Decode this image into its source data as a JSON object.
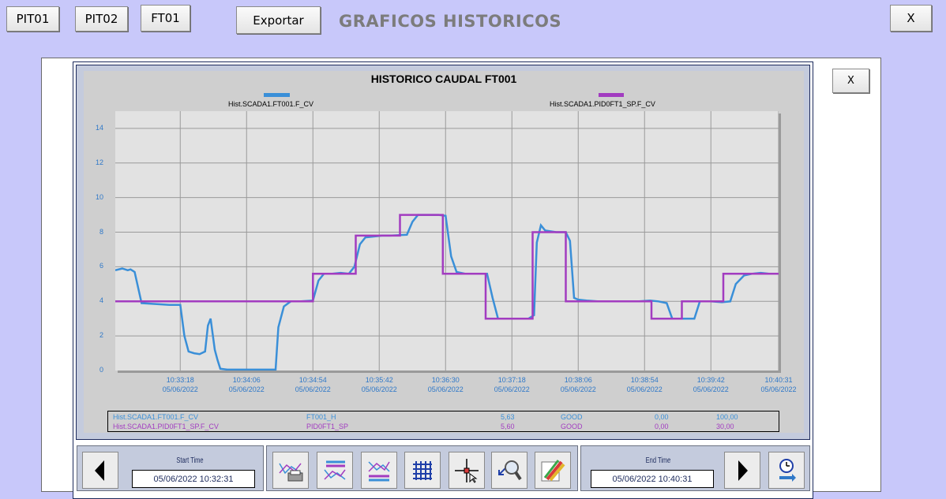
{
  "toolbar": {
    "buttons": [
      "PIT01",
      "PIT02",
      "FT01"
    ],
    "export_label": "Exportar",
    "title": "GRAFICOS HISTORICOS",
    "close_label": "X"
  },
  "panel": {
    "close_label": "X"
  },
  "chart_data": {
    "type": "line",
    "title": "HISTORICO CAUDAL FT001",
    "ylim": [
      0,
      15
    ],
    "yticks": [
      "0",
      "2",
      "4",
      "6",
      "8",
      "10",
      "12",
      "14"
    ],
    "x_times": [
      "10:33:18",
      "10:34:06",
      "10:34:54",
      "10:35:42",
      "10:36:30",
      "10:37:18",
      "10:38:06",
      "10:38:54",
      "10:39:42",
      "10:40:31"
    ],
    "x_dates": [
      "05/06/2022",
      "05/06/2022",
      "05/06/2022",
      "05/06/2022",
      "05/06/2022",
      "05/06/2022",
      "05/06/2022",
      "05/06/2022",
      "05/06/2022",
      "05/06/2022"
    ],
    "grid": true,
    "series": [
      {
        "name": "Hist.SCADA1.FT001.F_CV",
        "color": "#3a8fd8",
        "x": [
          "10:32:31",
          "10:32:36",
          "10:32:40",
          "10:32:42",
          "10:32:45",
          "10:32:50",
          "10:33:00",
          "10:33:10",
          "10:33:16",
          "10:33:18",
          "10:33:21",
          "10:33:24",
          "10:33:28",
          "10:33:32",
          "10:33:36",
          "10:33:38",
          "10:33:40",
          "10:33:43",
          "10:33:45",
          "10:33:47",
          "10:33:52",
          "10:33:54",
          "10:34:00",
          "10:34:10",
          "10:34:20",
          "10:34:27",
          "10:34:29",
          "10:34:33",
          "10:34:38",
          "10:34:45",
          "10:34:54",
          "10:34:58",
          "10:35:02",
          "10:35:08",
          "10:35:14",
          "10:35:20",
          "10:35:24",
          "10:35:28",
          "10:35:32",
          "10:35:38",
          "10:35:44",
          "10:35:50",
          "10:36:02",
          "10:36:06",
          "10:36:10",
          "10:36:15",
          "10:36:25",
          "10:36:30",
          "10:36:34",
          "10:36:38",
          "10:36:44",
          "10:36:50",
          "10:37:00",
          "10:37:04",
          "10:37:08",
          "10:37:14",
          "10:37:20",
          "10:37:30",
          "10:37:34",
          "10:37:36",
          "10:37:39",
          "10:37:42",
          "10:37:50",
          "10:37:57",
          "10:38:00",
          "10:38:03",
          "10:38:06",
          "10:38:12",
          "10:38:20",
          "10:38:30",
          "10:38:40",
          "10:38:50",
          "10:38:58",
          "10:39:04",
          "10:39:10",
          "10:39:14",
          "10:39:20",
          "10:39:30",
          "10:39:34",
          "10:39:42",
          "10:39:50",
          "10:39:56",
          "10:40:00",
          "10:40:06",
          "10:40:12",
          "10:40:18",
          "10:40:24",
          "10:40:31"
        ],
        "values": [
          5.8,
          5.9,
          5.8,
          5.85,
          5.7,
          3.9,
          3.85,
          3.8,
          3.8,
          3.8,
          2.0,
          1.1,
          1.0,
          0.95,
          1.1,
          2.6,
          3.0,
          1.2,
          0.6,
          0.1,
          0.05,
          0.05,
          0.05,
          0.05,
          0.05,
          0.05,
          2.5,
          3.7,
          4.0,
          4.0,
          4.05,
          5.2,
          5.6,
          5.6,
          5.65,
          5.6,
          6.0,
          7.3,
          7.7,
          7.75,
          7.8,
          7.8,
          7.85,
          8.6,
          9.0,
          9.0,
          9.0,
          8.95,
          6.6,
          5.7,
          5.6,
          5.6,
          5.6,
          4.2,
          3.0,
          3.0,
          3.0,
          3.0,
          3.2,
          7.4,
          8.4,
          8.1,
          8.0,
          8.0,
          7.5,
          4.2,
          4.1,
          4.05,
          4.0,
          4.0,
          4.0,
          4.0,
          4.05,
          4.0,
          3.9,
          3.0,
          3.0,
          3.0,
          4.0,
          4.0,
          3.95,
          4.0,
          5.0,
          5.5,
          5.6,
          5.65,
          5.6,
          5.6
        ]
      },
      {
        "name": "Hist.SCADA1.PID0FT1_SP.F_CV",
        "color": "#a23cc0",
        "x": [
          "10:32:31",
          "10:34:54",
          "10:34:54",
          "10:35:25",
          "10:35:25",
          "10:35:57",
          "10:35:57",
          "10:36:28",
          "10:36:28",
          "10:36:59",
          "10:36:59",
          "10:37:33",
          "10:37:33",
          "10:37:57",
          "10:37:57",
          "10:38:59",
          "10:38:59",
          "10:39:21",
          "10:39:21",
          "10:39:51",
          "10:39:51",
          "10:40:31"
        ],
        "values": [
          4,
          4,
          5.6,
          5.6,
          7.8,
          7.8,
          9,
          9,
          5.6,
          5.6,
          3,
          3,
          8,
          8,
          4,
          4,
          3,
          3,
          4,
          4,
          5.6,
          5.6
        ]
      }
    ]
  },
  "stats": {
    "rows": [
      {
        "name": "Hist.SCADA1.FT001.F_CV",
        "tag": "FT001_H",
        "value": "5,63",
        "quality": "GOOD",
        "min": "0,00",
        "max": "100,00",
        "color": "#3a8fd8"
      },
      {
        "name": "Hist.SCADA1.PID0FT1_SP.F_CV",
        "tag": "PID0FT1_SP",
        "value": "5,60",
        "quality": "GOOD",
        "min": "0,00",
        "max": "30,00",
        "color": "#a23cc0"
      }
    ]
  },
  "time": {
    "start_label": "Start Time",
    "start_value": "05/06/2022 10:32:31",
    "end_label": "End Time",
    "end_value": "05/06/2022 10:40:31"
  },
  "icons": [
    "print-chart-icon",
    "legend-config-icon",
    "pens-icon",
    "grid-icon",
    "crosshair-cursor-icon",
    "zoom-icon",
    "edit-pens-icon",
    "refresh-clock-icon",
    "arrow-left-icon",
    "arrow-right-icon"
  ]
}
